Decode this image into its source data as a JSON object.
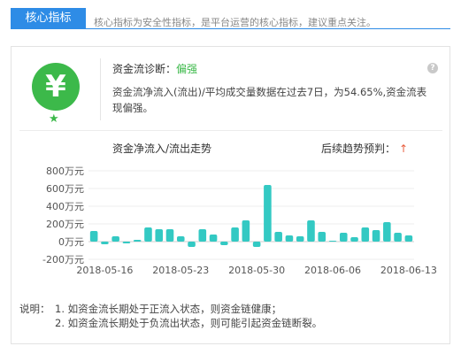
{
  "header": {
    "tab_label": "核心指标",
    "description": "核心指标为安全性指标，是平台运营的核心指标，建议重点关注。"
  },
  "diagnosis": {
    "icon_symbol": "¥",
    "label": "资金流诊断：",
    "value": "偏强",
    "help_symbol": "?",
    "detail": "资金流净流入(流出)/平均成交量数据在过去7日，为54.65%,资金流表现偏强。"
  },
  "chart_section": {
    "title": "资金净流入/流出走势",
    "trend_label": "后续趋势预判：",
    "trend_arrow": "↑"
  },
  "notes": {
    "label": "说明：",
    "items": [
      "1. 如资金流长期处于正流入状态，则资金链健康；",
      "2. 如资金流长期处于负流出状态，则可能引起资金链断裂。"
    ]
  },
  "colors": {
    "accent": "#2e8ce6",
    "positive": "#3cb94a",
    "bar": "#33c9c3",
    "up_arrow": "#e85d3d"
  },
  "chart_data": {
    "type": "bar",
    "y_ticks": [
      "800万元",
      "600万元",
      "400万元",
      "200万元",
      "0万元",
      "-200万元"
    ],
    "y_tick_values": [
      800,
      600,
      400,
      200,
      0,
      -200
    ],
    "ylim": [
      -200,
      800
    ],
    "x_tick_labels": [
      "2018-05-16",
      "2018-05-23",
      "2018-05-30",
      "2018-06-06",
      "2018-06-13"
    ],
    "values": [
      120,
      -30,
      60,
      -20,
      20,
      160,
      140,
      140,
      60,
      -60,
      140,
      80,
      -40,
      160,
      240,
      -60,
      640,
      110,
      70,
      60,
      240,
      110,
      10,
      100,
      50,
      160,
      130,
      220,
      100,
      70
    ]
  }
}
